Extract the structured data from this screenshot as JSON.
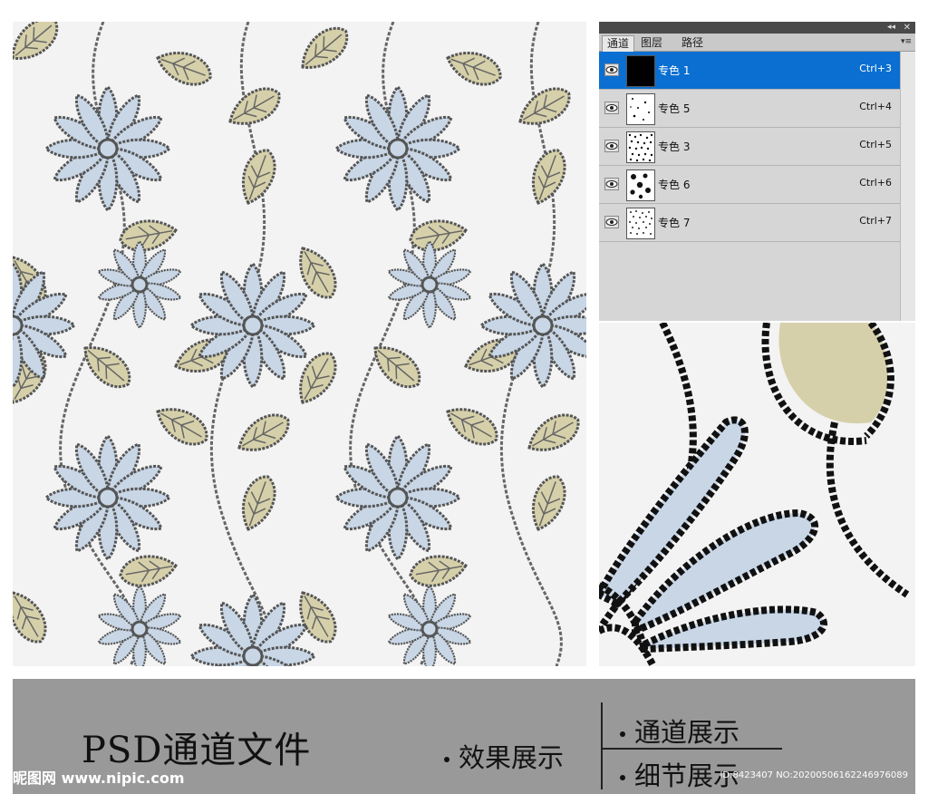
{
  "panel": {
    "tabs": [
      "通道",
      "图层",
      "路径"
    ],
    "active_tab": "通道",
    "channels": [
      {
        "name": "专色 1",
        "shortcut": "Ctrl+3",
        "selected": true
      },
      {
        "name": "专色 5",
        "shortcut": "Ctrl+4",
        "selected": false
      },
      {
        "name": "专色 3",
        "shortcut": "Ctrl+5",
        "selected": false
      },
      {
        "name": "专色 6",
        "shortcut": "Ctrl+6",
        "selected": false
      },
      {
        "name": "专色 7",
        "shortcut": "Ctrl+7",
        "selected": false
      }
    ]
  },
  "banner": {
    "title": "PSD通道文件",
    "effect_label": "效果展示",
    "channel_label": "通道展示",
    "detail_label": "细节展示"
  },
  "watermark": {
    "site": "昵图网 www.nipic.com",
    "id_text": "ID:8423407 NO:20200506162246976089"
  },
  "colors": {
    "petal": "#c8d6e6",
    "leaf": "#d6d0aa",
    "rope": "#5a5a5a",
    "selection": "#0a6fd1",
    "banner": "#999999"
  }
}
